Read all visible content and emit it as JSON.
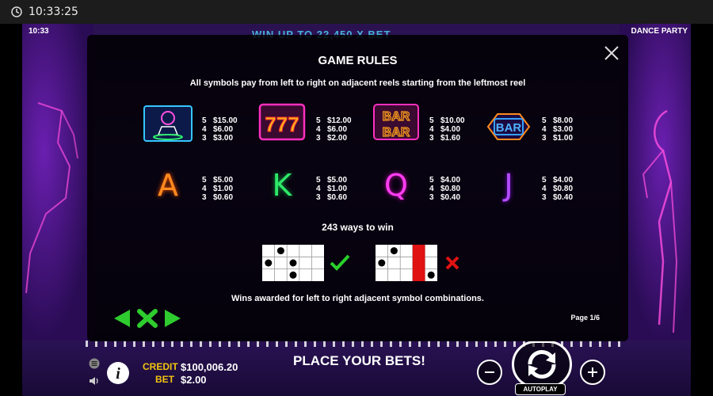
{
  "os": {
    "time": "10:33:25"
  },
  "game": {
    "top_time": "10:33",
    "top_title": "DANCE PARTY",
    "banner": "WIN UP TO 22,450 X BET"
  },
  "rules": {
    "title": "GAME RULES",
    "subtitle": "All symbols pay from left to right on adjacent reels starting from the leftmost reel",
    "symbols_row1": [
      {
        "icon": "dj-symbol-icon",
        "pays": [
          [
            "5",
            "$15.00"
          ],
          [
            "4",
            "$6.00"
          ],
          [
            "3",
            "$3.00"
          ]
        ]
      },
      {
        "icon": "triple-seven-symbol-icon",
        "label": "777",
        "pays": [
          [
            "5",
            "$12.00"
          ],
          [
            "4",
            "$6.00"
          ],
          [
            "3",
            "$2.00"
          ]
        ]
      },
      {
        "icon": "double-bar-symbol-icon",
        "label": "BAR",
        "pays": [
          [
            "5",
            "$10.00"
          ],
          [
            "4",
            "$4.00"
          ],
          [
            "3",
            "$1.60"
          ]
        ]
      },
      {
        "icon": "bar-symbol-icon",
        "label": "BAR",
        "pays": [
          [
            "5",
            "$8.00"
          ],
          [
            "4",
            "$3.00"
          ],
          [
            "3",
            "$1.00"
          ]
        ]
      }
    ],
    "symbols_row2": [
      {
        "icon": "letter-a-symbol-icon",
        "label": "A",
        "color": "#ff8a1e",
        "pays": [
          [
            "5",
            "$5.00"
          ],
          [
            "4",
            "$1.00"
          ],
          [
            "3",
            "$0.60"
          ]
        ]
      },
      {
        "icon": "letter-k-symbol-icon",
        "label": "K",
        "color": "#2ee86a",
        "pays": [
          [
            "5",
            "$5.00"
          ],
          [
            "4",
            "$1.00"
          ],
          [
            "3",
            "$0.60"
          ]
        ]
      },
      {
        "icon": "letter-q-symbol-icon",
        "label": "Q",
        "color": "#ff3df0",
        "pays": [
          [
            "5",
            "$4.00"
          ],
          [
            "4",
            "$0.80"
          ],
          [
            "3",
            "$0.40"
          ]
        ]
      },
      {
        "icon": "letter-j-symbol-icon",
        "label": "J",
        "color": "#b44dff",
        "pays": [
          [
            "5",
            "$4.00"
          ],
          [
            "4",
            "$0.80"
          ],
          [
            "3",
            "$0.40"
          ]
        ]
      }
    ],
    "ways_title": "243 ways to win",
    "wins_text": "Wins awarded for left to right adjacent symbol combinations.",
    "page": "Page 1/6",
    "colors": {
      "valid": "#2ad12a",
      "invalid": "#e01212",
      "arrow": "#2ecc2e"
    }
  },
  "bottom": {
    "credit_label": "CREDIT",
    "credit_value": "$100,006.20",
    "bet_label": "BET",
    "bet_value": "$2.00",
    "place_bets": "PLACE YOUR BETS!",
    "autoplay": "AUTOPLAY"
  }
}
